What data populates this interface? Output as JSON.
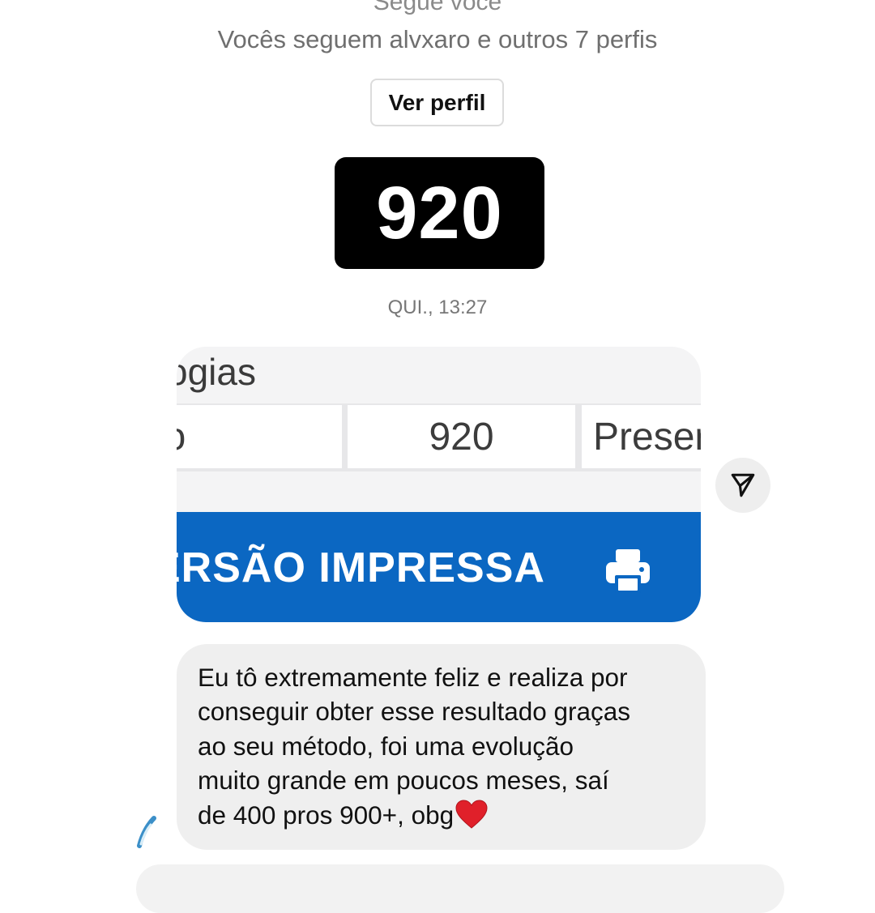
{
  "profile_header": {
    "follows_you": "Segue você",
    "mutual_text": "Vocês seguem alvxaro e outros 7 perfis",
    "view_profile_label": "Ver perfil"
  },
  "messages": {
    "score_badge": "920",
    "timestamp": "QUI., 13:27",
    "image_message": {
      "heading_fragment": "ogias",
      "row_cells": [
        "io",
        "920",
        "Preser"
      ],
      "banner_text": "ERSÃO IMPRESSA",
      "banner_icon": "printer-icon",
      "colors": {
        "banner": "#0b67c2",
        "table_bg": "#e7e7e9"
      }
    },
    "share_icon": "send-icon",
    "text_message": {
      "lines": [
        "Eu tô extremamente feliz e realiza por",
        "conseguir obter esse resultado graças",
        "ao seu método, foi uma evolução",
        "muito grande em poucos meses, saí",
        "de 400 pros 900+, obg"
      ],
      "emoji": "❤️"
    }
  },
  "colors": {
    "bubble": "#efefef",
    "badge": "#000000",
    "heart": "#e0202a"
  }
}
